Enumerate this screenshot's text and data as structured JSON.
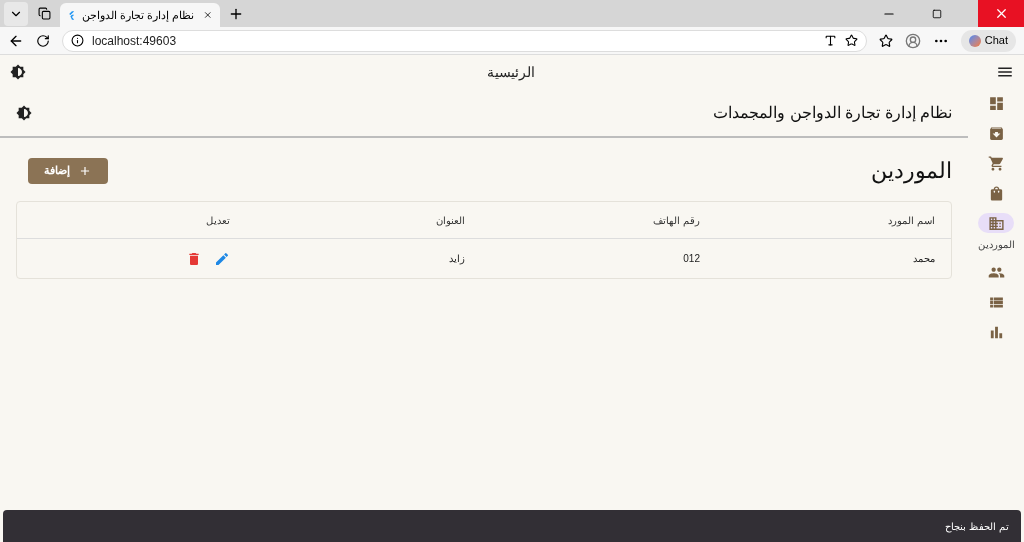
{
  "browser": {
    "tab_title": "نظام إدارة تجارة الدواجن",
    "url": "localhost:49603",
    "chat_label": "Chat"
  },
  "app_bar": {
    "title": "الرئيسية"
  },
  "header": {
    "title": "نظام إدارة تجارة الدواجن والمجمدات"
  },
  "page": {
    "title": "الموردين",
    "add_button": "إضافة"
  },
  "nav": [
    {
      "selected": false
    },
    {
      "selected": false
    },
    {
      "selected": false
    },
    {
      "selected": false
    },
    {
      "selected": true,
      "label": "الموردين"
    },
    {
      "selected": false
    },
    {
      "selected": false
    },
    {
      "selected": false
    }
  ],
  "table": {
    "columns": [
      "اسم المورد",
      "رقم الهاتف",
      "العنوان",
      "تعديل"
    ],
    "rows": [
      {
        "cells": [
          "محمد",
          "012",
          "زايد"
        ]
      }
    ]
  },
  "snackbar": {
    "message": "تم الحفظ بنجاح"
  }
}
